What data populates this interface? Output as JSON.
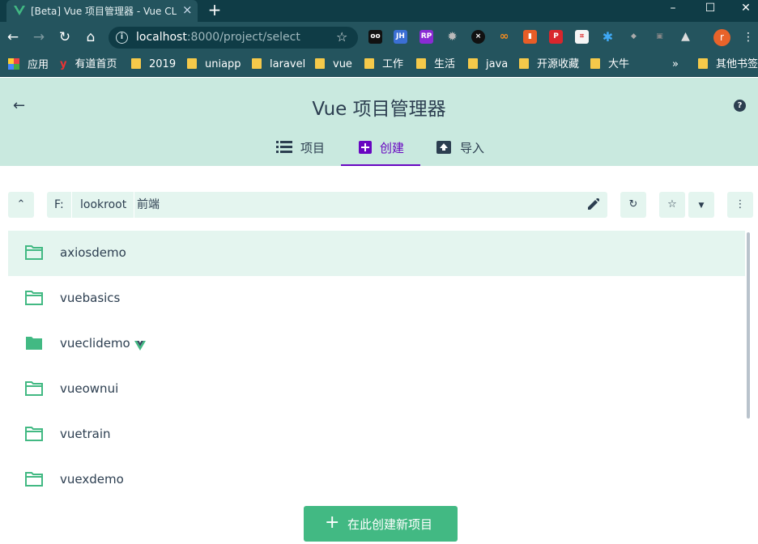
{
  "browser": {
    "tab_title": "[Beta] Vue 项目管理器 - Vue CLI",
    "new_tab": "+",
    "url_host": "localhost",
    "url_path": ":8000/project/select",
    "bookmarks": [
      "应用",
      "有道首页",
      "2019",
      "uniapp",
      "laravel",
      "vue",
      "工作",
      "生活",
      "java",
      "开源收藏",
      "大牛",
      "其他书签"
    ],
    "overflow": "»",
    "avatar_letter": "r",
    "extensions": [
      "JH",
      "RP"
    ]
  },
  "app": {
    "title": "Vue 项目管理器",
    "tabs": [
      {
        "label": "项目",
        "icon": "list-icon"
      },
      {
        "label": "创建",
        "icon": "add-box-icon"
      },
      {
        "label": "导入",
        "icon": "import-icon"
      }
    ],
    "active_tab": "创建",
    "accent": "#6806c1",
    "brand": "#42b983"
  },
  "path": {
    "segments": [
      "F:",
      "lookroot",
      "前端"
    ]
  },
  "folders": [
    {
      "name": "axiosdemo",
      "selected": true,
      "vue_project": false,
      "filled_icon": false
    },
    {
      "name": "vuebasics",
      "selected": false,
      "vue_project": false,
      "filled_icon": false
    },
    {
      "name": "vueclidemo",
      "selected": false,
      "vue_project": true,
      "filled_icon": true
    },
    {
      "name": "vueownui",
      "selected": false,
      "vue_project": false,
      "filled_icon": false
    },
    {
      "name": "vuetrain",
      "selected": false,
      "vue_project": false,
      "filled_icon": false
    },
    {
      "name": "vuexdemo",
      "selected": false,
      "vue_project": false,
      "filled_icon": false
    }
  ],
  "create_button": {
    "plus": "+",
    "label": "在此创建新项目"
  }
}
